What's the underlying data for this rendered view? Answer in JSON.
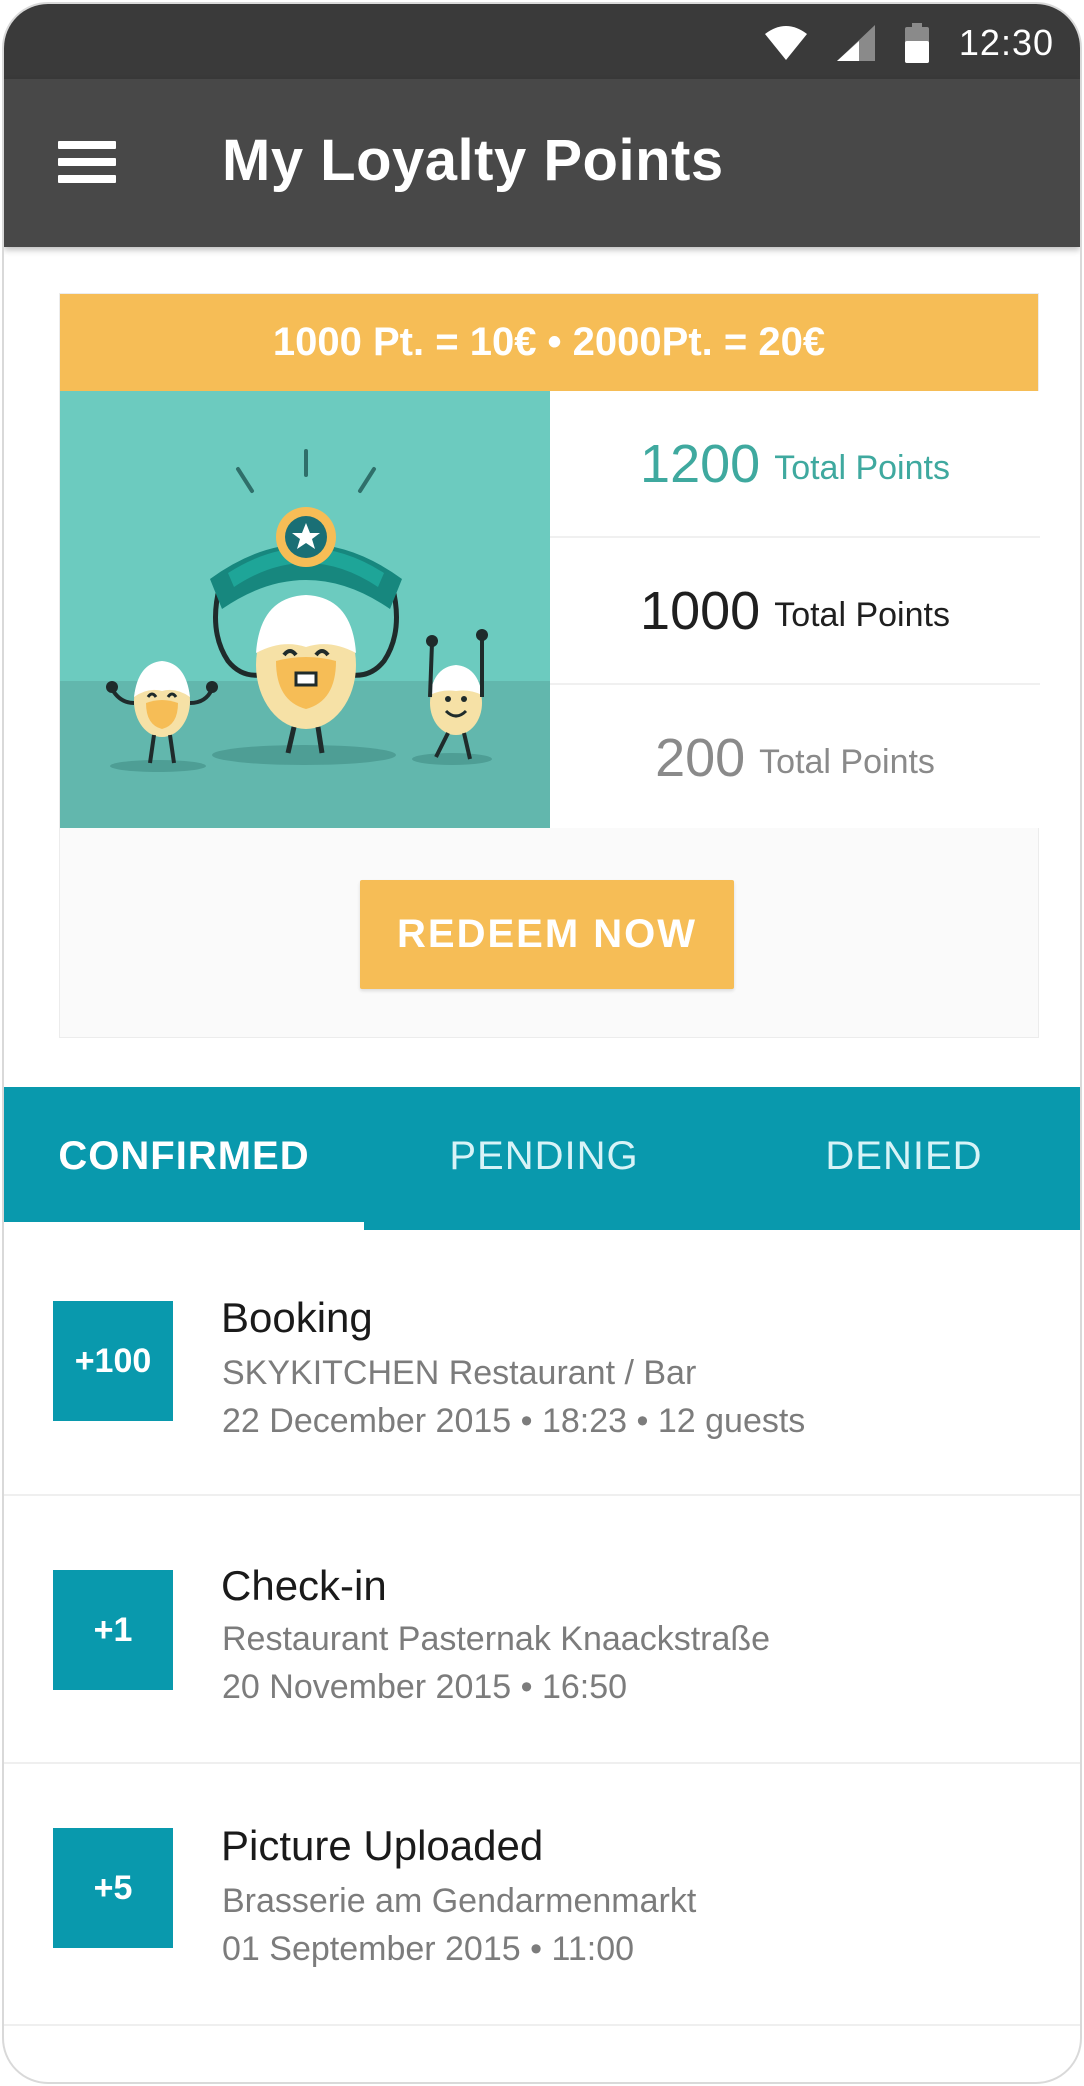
{
  "status_bar": {
    "time": "12:30",
    "icons": [
      "wifi-icon",
      "signal-icon",
      "battery-icon"
    ]
  },
  "app_bar": {
    "title": "My Loyalty Points",
    "menu_icon": "hamburger-menu-icon"
  },
  "loyalty_card": {
    "rate_banner": "1000 Pt. = 10€ • 2000Pt. = 20€",
    "illustration": "egg-characters-celebrating",
    "points": [
      {
        "value": "1200",
        "label": "Total Points",
        "color": "#3fa99f"
      },
      {
        "value": "1000",
        "label": "Total Points",
        "color": "#1f1f1f"
      },
      {
        "value": "200",
        "label": "Total Points",
        "color": "#8a8a8a"
      }
    ],
    "redeem_label": "REDEEM NOW"
  },
  "tabs": [
    {
      "label": "CONFIRMED",
      "active": true
    },
    {
      "label": "PENDING",
      "active": false
    },
    {
      "label": "DENIED",
      "active": false
    }
  ],
  "transactions": [
    {
      "points": "+100",
      "title": "Booking",
      "place": "SKYKITCHEN Restaurant / Bar",
      "details": "22 December 2015 • 18:23 • 12 guests"
    },
    {
      "points": "+1",
      "title": "Check-in",
      "place": "Restaurant Pasternak Knaackstraße",
      "details": "20 November 2015 • 16:50"
    },
    {
      "points": "+5",
      "title": "Picture Uploaded",
      "place": "Brasserie am Gendarmenmarkt",
      "details": "01 September 2015 • 11:00"
    }
  ],
  "colors": {
    "accent": "#0999ad",
    "highlight": "#f6bd56",
    "app_bar": "#484848",
    "illustration_bg": "#6ccbbf"
  }
}
